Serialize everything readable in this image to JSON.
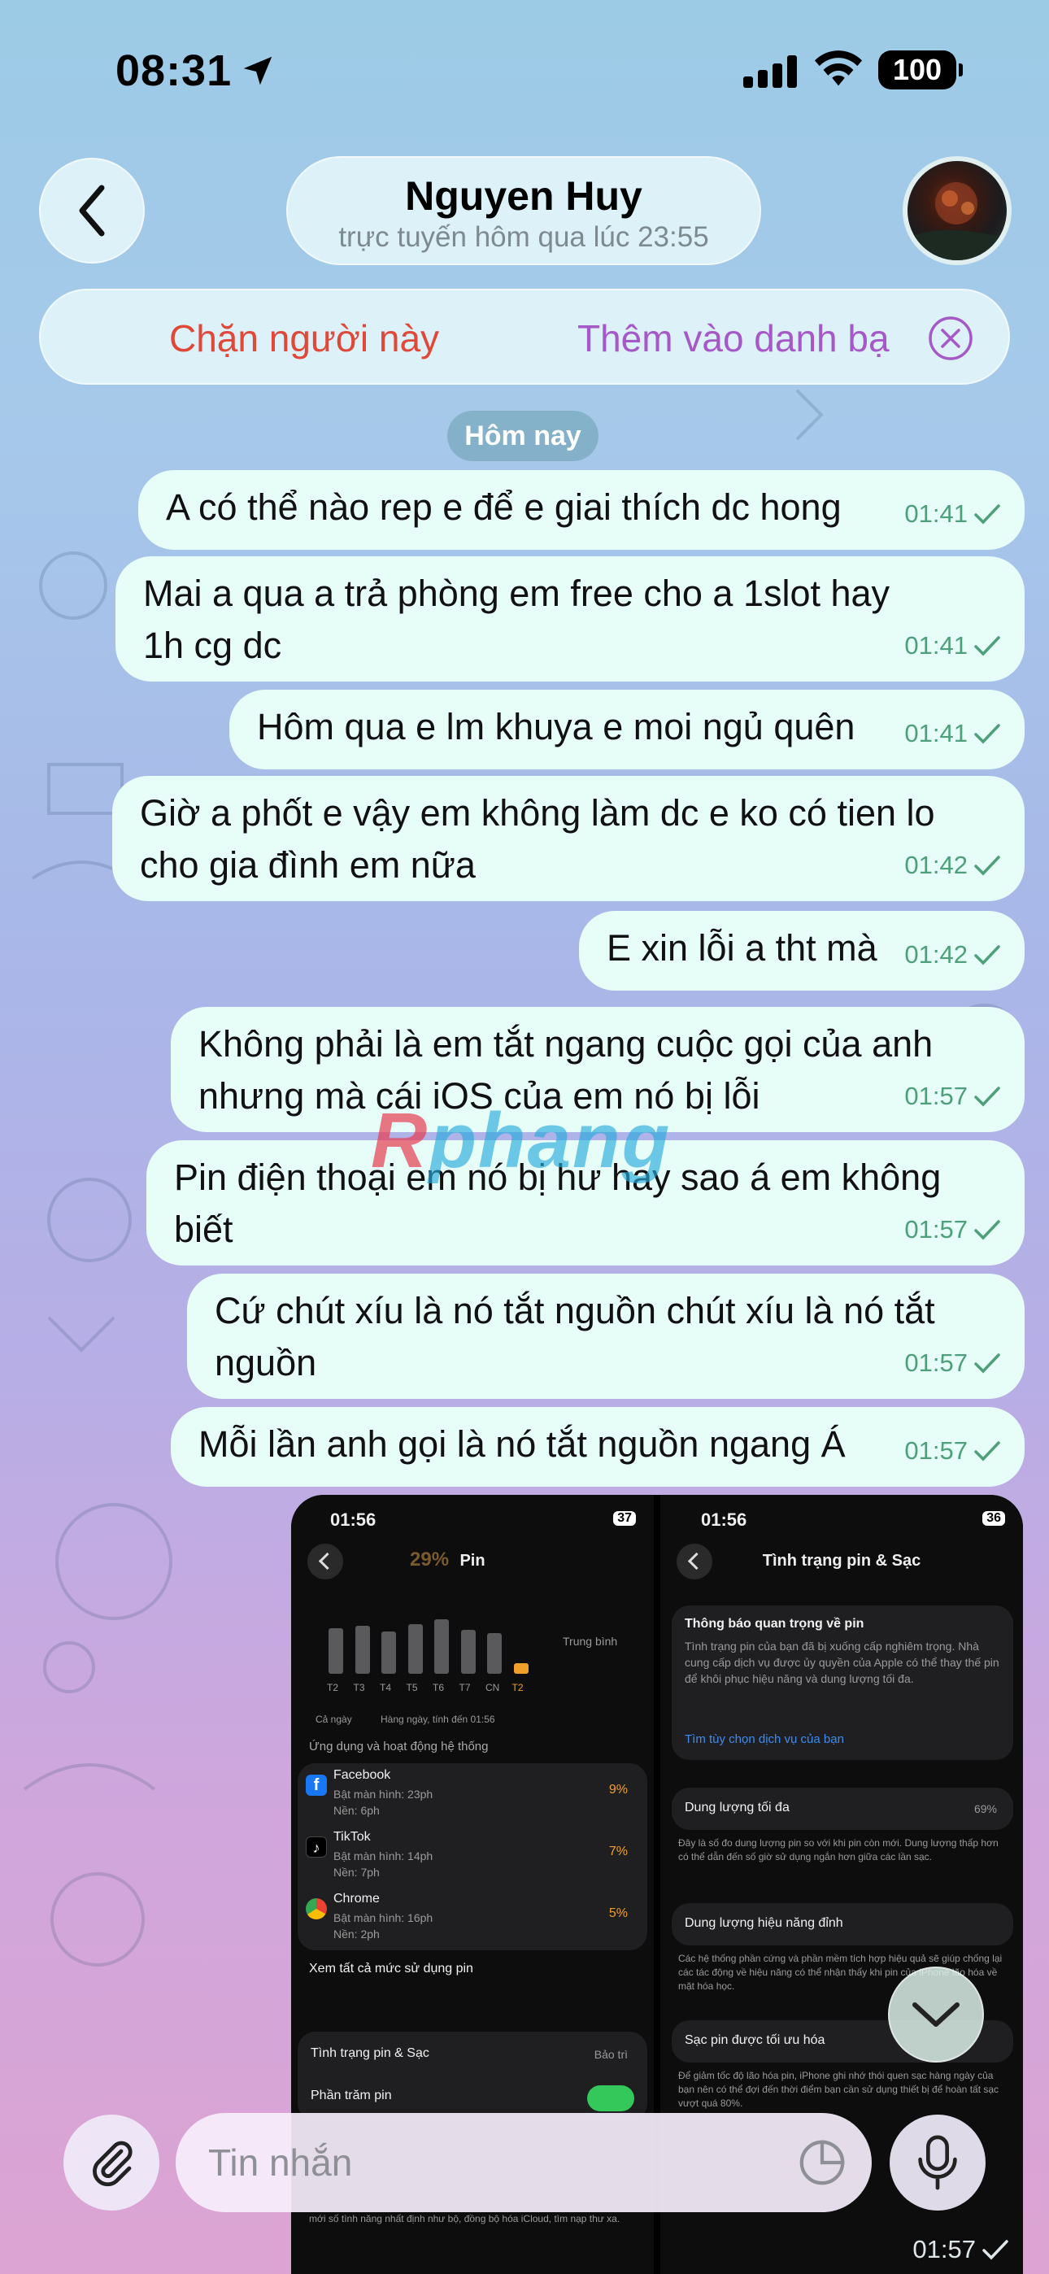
{
  "status_bar": {
    "time": "08:31",
    "battery": "100"
  },
  "header": {
    "name": "Nguyen Huy",
    "status": "trực tuyến hôm qua lúc 23:55"
  },
  "action_bar": {
    "block_label": "Chặn người này",
    "add_contact_label": "Thêm vào danh bạ"
  },
  "date_chip": "Hôm nay",
  "messages": [
    {
      "text": "A có thể nào rep e để e giai thích dc hong",
      "time": "01:41"
    },
    {
      "text": "Mai a qua a trả phòng em free cho a 1slot hay 1h cg dc",
      "time": "01:41"
    },
    {
      "text": "Hôm qua e lm khuya e moi ngủ quên",
      "time": "01:41"
    },
    {
      "text": "Giờ a phốt e vậy em không làm dc e ko có tien lo cho gia đình em nữa",
      "time": "01:42"
    },
    {
      "text": "E xin lỗi a tht mà",
      "time": "01:42"
    },
    {
      "text": "Không phải là em tắt ngang cuộc gọi của anh nhưng mà cái iOS của em nó bị lỗi",
      "time": "01:57"
    },
    {
      "text": "Pin điện thoại em nó bị hư hay sao á em không biết",
      "time": "01:57"
    },
    {
      "text": "Cứ chút xíu là nó tắt nguồn chút xíu là nó tắt nguồn",
      "time": "01:57"
    },
    {
      "text": "Mỗi lần anh gọi là nó tắt nguồn ngang Á",
      "time": "01:57"
    }
  ],
  "image_message": {
    "time": "01:57",
    "left_shot": {
      "time": "01:56",
      "battery": "37",
      "title": "Pin",
      "percent": "29%",
      "chart_days": [
        "T2",
        "T3",
        "T4",
        "T5",
        "T6",
        "T7",
        "CN",
        "T2"
      ],
      "chart_values": [
        0.62,
        0.66,
        0.58,
        0.68,
        0.74,
        0.6,
        0.56,
        0.14
      ],
      "avg_label": "Trung bình",
      "legend_all": "Cả ngày",
      "legend_daily": "Hàng ngày, tính đến 01:56",
      "section": "Ứng dụng và hoạt động hệ thống",
      "apps": [
        {
          "name": "Facebook",
          "screen": "Bật màn hình: 23ph",
          "bg": "Nền: 6ph",
          "pct": "9%"
        },
        {
          "name": "TikTok",
          "screen": "Bật màn hình: 14ph",
          "bg": "Nền: 7ph",
          "pct": "7%"
        },
        {
          "name": "Chrome",
          "screen": "Bật màn hình: 16ph",
          "bg": "Nền: 2ph",
          "pct": "5%"
        }
      ],
      "see_all": "Xem tất cả mức sử dụng pin",
      "health_row": "Tình trạng pin & Sạc",
      "health_value": "Bảo trì",
      "percent_row": "Phần trăm pin",
      "footer_note": "mới số tình năng nhất định như bộ, đồng bộ hóa iCloud, tìm nạp thư xa."
    },
    "right_shot": {
      "time": "01:56",
      "battery": "36",
      "title": "Tình trạng pin & Sạc",
      "notice_title": "Thông báo quan trọng về pin",
      "notice_body": "Tình trạng pin của bạn đã bị xuống cấp nghiêm trọng. Nhà cung cấp dịch vụ được ủy quyền của Apple có thể thay thế pin để khôi phục hiệu năng và dung lượng tối đa.",
      "notice_link": "Tìm tùy chọn dịch vụ của bạn",
      "capacity_label": "Dung lượng tối đa",
      "capacity_value": "69%",
      "capacity_desc": "Đây là số đo dung lượng pin so với khi pin còn mới. Dung lượng thấp hơn có thể dẫn đến số giờ sử dụng ngắn hơn giữa các lần sạc.",
      "perf_label": "Dung lượng hiệu năng đỉnh",
      "perf_desc": "Các hệ thống phần cứng và phần mềm tích hợp hiệu quả sẽ giúp chống lại các tác động về hiệu năng có thể nhận thấy khi pin của iPhone lão hóa về mặt hóa học.",
      "opt_label": "Sạc pin được tối ưu hóa",
      "opt_desc": "Để giảm tốc độ lão hóa pin, iPhone ghi nhớ thói quen sạc hàng ngày của bạn nên có thể đợi đến thời điểm bạn cần sử dụng thiết bị để hoàn tất sạc vượt quá 80%."
    }
  },
  "watermark": {
    "part1": "R",
    "part2": "phang"
  },
  "input": {
    "placeholder": "Tin nhắn"
  },
  "colors": {
    "block": "#e0483a",
    "add_contact": "#a558c8",
    "bubble": "#e6fdf8",
    "time_green": "#4da07a"
  }
}
